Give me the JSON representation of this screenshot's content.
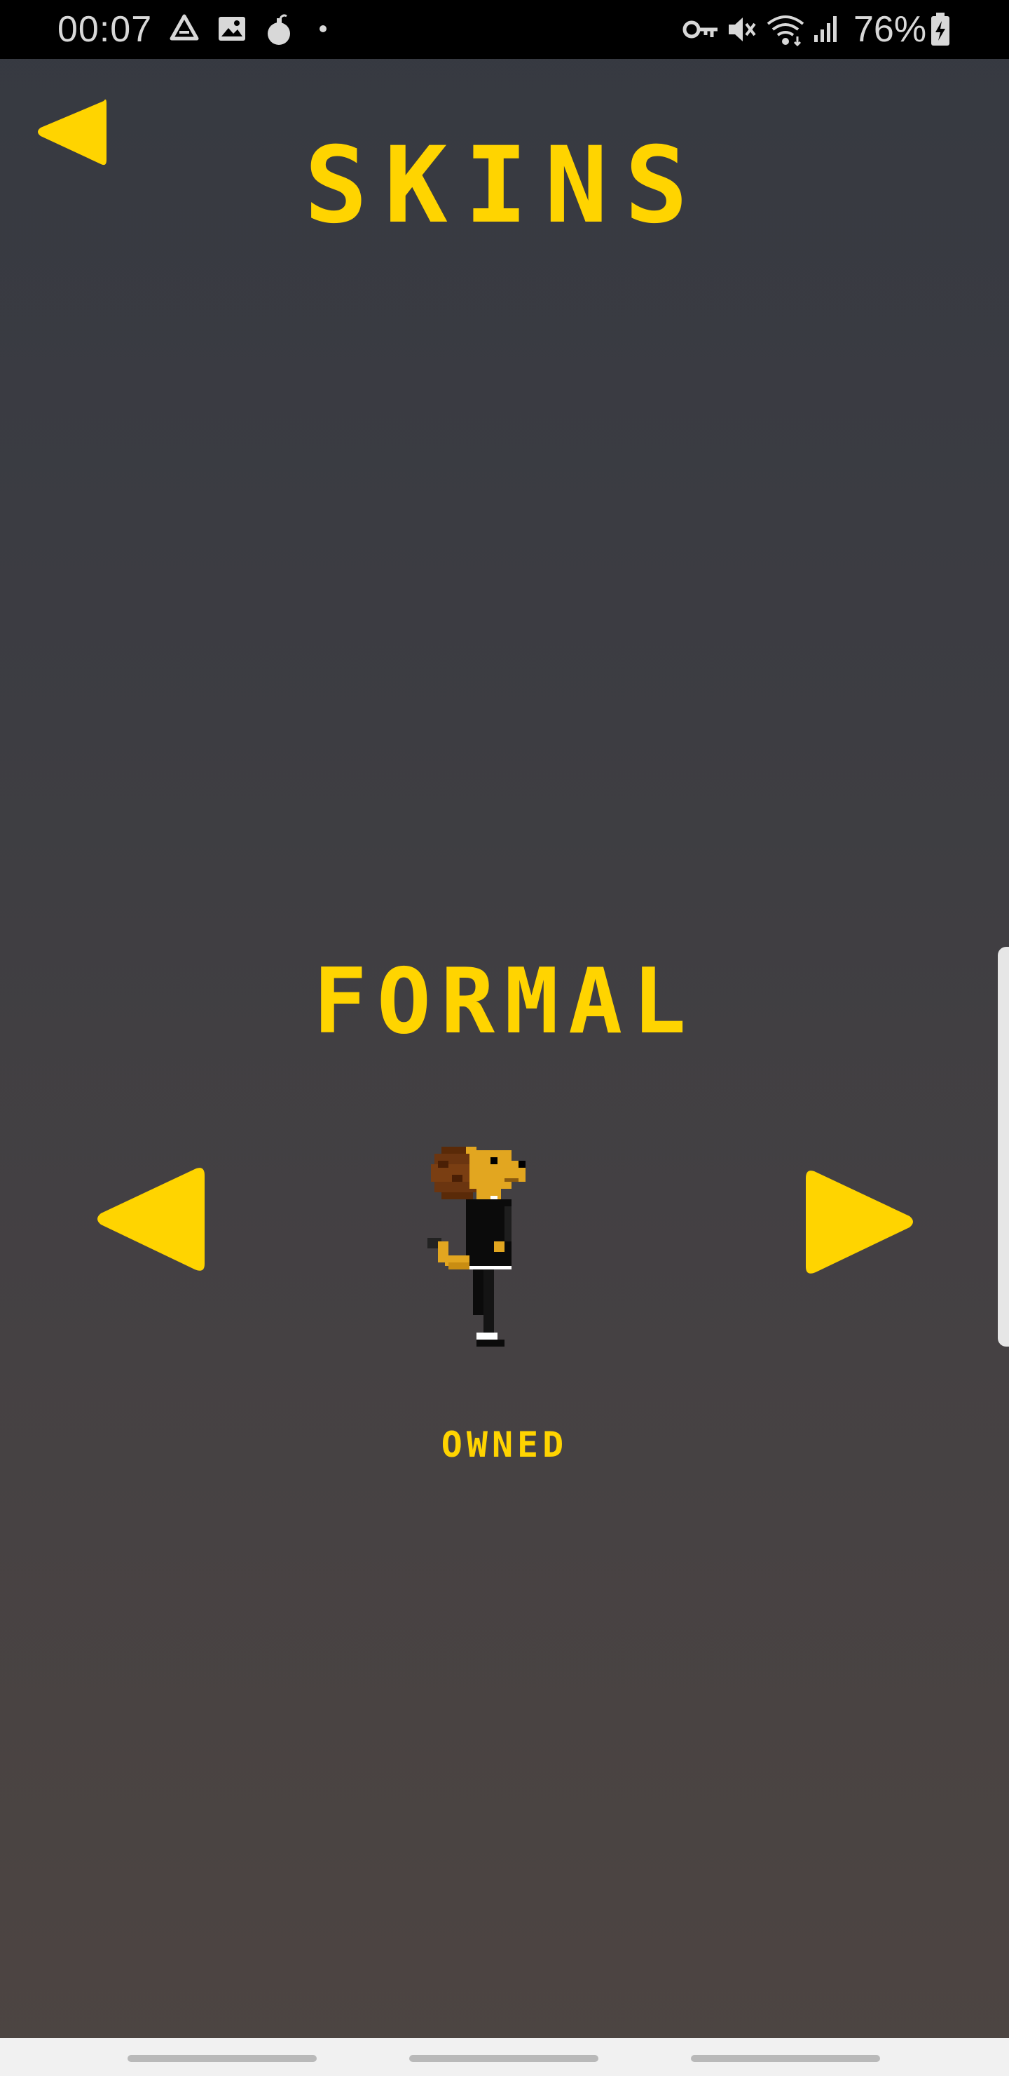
{
  "status_bar": {
    "time": "00:07",
    "battery": "76%",
    "left_icons": [
      "drive-icon",
      "image-icon",
      "bomb-icon",
      "dot-icon"
    ],
    "right_icons": [
      "vpn-key-icon",
      "mute-icon",
      "wifi-icon",
      "signal-icon",
      "battery-charging-icon"
    ]
  },
  "screen": {
    "title": "SKINS",
    "skin_name": "FORMAL",
    "skin_status": "OWNED"
  },
  "colors": {
    "accent": "#ffd400",
    "background_top": "#363941",
    "background_bottom": "#4d4542",
    "status_bar": "#000000"
  },
  "icons": {
    "back": "back-arrow-icon",
    "previous": "previous-skin-icon",
    "next": "next-skin-icon"
  }
}
